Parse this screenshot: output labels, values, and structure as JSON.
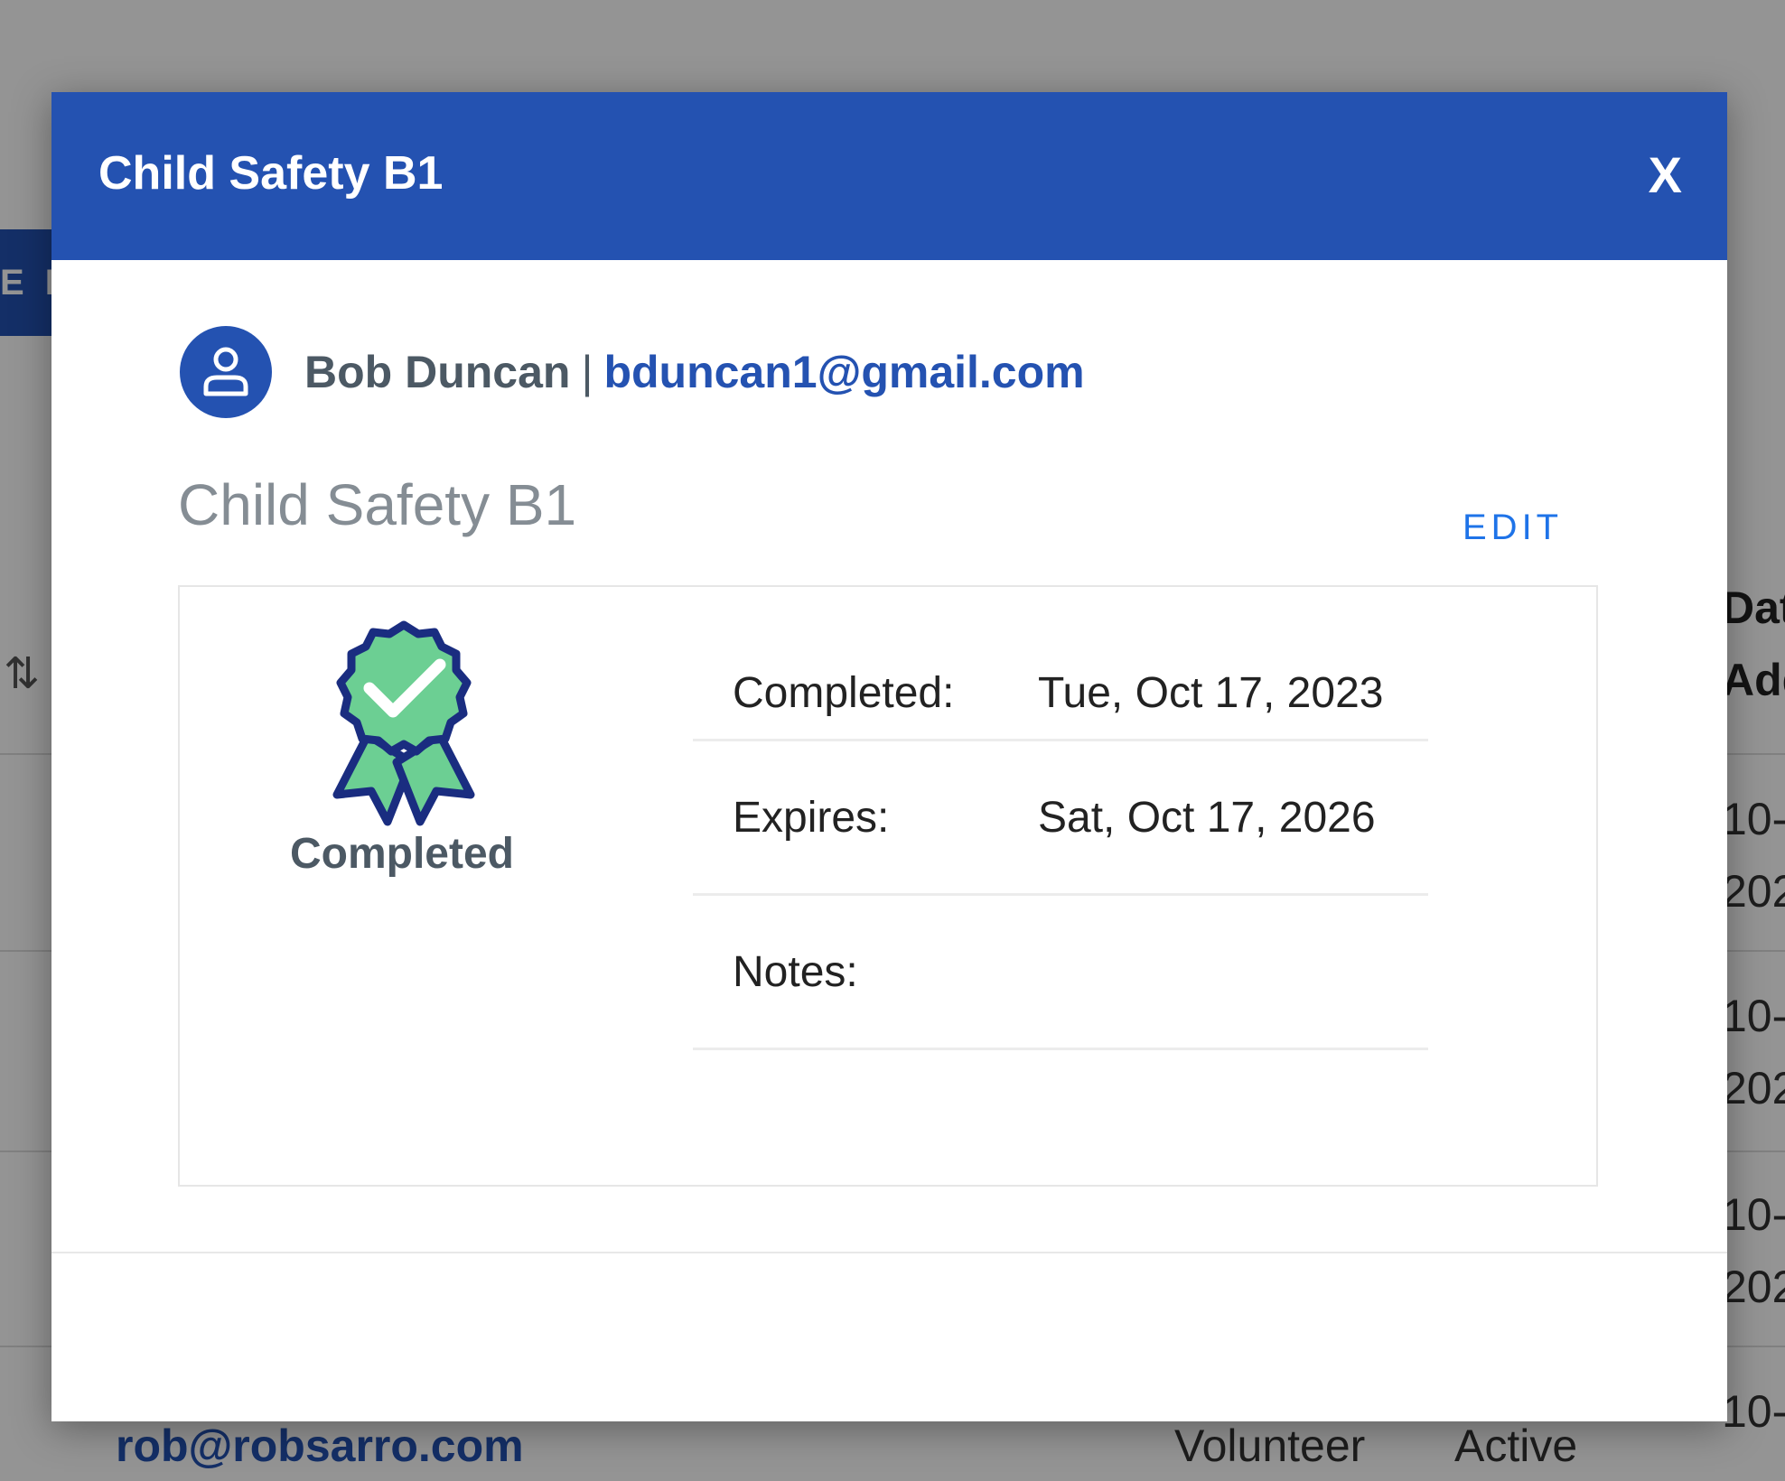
{
  "background": {
    "tab_label": "E R",
    "sort_icon": "sort-arrows-icon",
    "column_header": [
      "Dat",
      "Add"
    ],
    "rows": [
      [
        "10-",
        "202"
      ],
      [
        "10-",
        "202"
      ],
      [
        "10-",
        "202"
      ],
      [
        "10-",
        "202"
      ]
    ],
    "last_row": {
      "email": "rob@robsarro.com",
      "role": "Volunteer",
      "status": "Active"
    }
  },
  "modal": {
    "title": "Child Safety B1",
    "close_label": "X",
    "user": {
      "avatar_icon": "user-icon",
      "name": "Bob Duncan",
      "separator": "|",
      "email": "bduncan1@gmail.com"
    },
    "section_title": "Child Safety B1",
    "edit_label": "EDIT",
    "badge": {
      "icon": "award-ribbon-check-icon",
      "label": "Completed",
      "color_fill": "#6ccf93",
      "color_outline": "#1a2d80"
    },
    "details": [
      {
        "label": "Completed:",
        "value": "Tue, Oct 17, 2023"
      },
      {
        "label": "Expires:",
        "value": "Sat, Oct 17, 2026"
      },
      {
        "label": "Notes:",
        "value": ""
      }
    ]
  },
  "colors": {
    "primary": "#2452b1",
    "link": "#1e73e8",
    "muted_text": "#858d94"
  }
}
